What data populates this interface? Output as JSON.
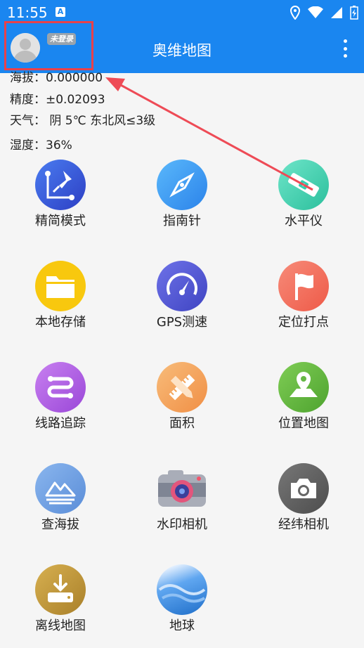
{
  "status": {
    "time": "11:55",
    "a_badge": "A"
  },
  "appbar": {
    "title": "奥维地图",
    "login_badge": "未登录"
  },
  "info": {
    "altitude": "海拔：0.000000",
    "accuracy": "精度：±0.02093",
    "weather": "天气：  阴  5℃  东北风≤3级",
    "humidity": "湿度：36%"
  },
  "tools": [
    {
      "label": "精简模式",
      "icon": "simple-mode-icon",
      "color": "#3a63e0"
    },
    {
      "label": "指南针",
      "icon": "compass-icon",
      "color": "#3a9cf2"
    },
    {
      "label": "水平仪",
      "icon": "level-icon",
      "color": "#34cfb0"
    },
    {
      "label": "本地存储",
      "icon": "folder-icon",
      "color": "#f7c70c"
    },
    {
      "label": "GPS测速",
      "icon": "speedometer-icon",
      "color": "#5a5fd6"
    },
    {
      "label": "定位打点",
      "icon": "flag-icon",
      "color": "#f26a5a"
    },
    {
      "label": "线路追踪",
      "icon": "route-icon",
      "color": "#b05fe0"
    },
    {
      "label": "面积",
      "icon": "ruler-pencil-icon",
      "color": "#f3a55a"
    },
    {
      "label": "位置地图",
      "icon": "map-pin-icon",
      "color": "#66b845"
    },
    {
      "label": "查海拔",
      "icon": "mountain-icon",
      "color": "#6fa1e2"
    },
    {
      "label": "水印相机",
      "icon": "camera-watermark-icon",
      "color": "#e45a7a"
    },
    {
      "label": "经纬相机",
      "icon": "camera-icon",
      "color": "#666666"
    },
    {
      "label": "离线地图",
      "icon": "download-icon",
      "color": "#c39a35"
    },
    {
      "label": "地球",
      "icon": "earth-icon",
      "color": "#2f86de"
    }
  ]
}
